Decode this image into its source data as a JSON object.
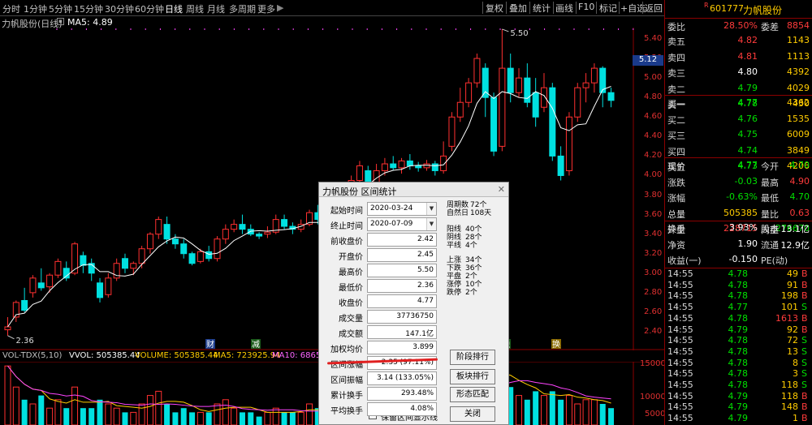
{
  "toolbar": {
    "periods": [
      "分时",
      "1分钟",
      "5分钟",
      "15分钟",
      "30分钟",
      "60分钟",
      "日线",
      "周线",
      "月线",
      "多周期",
      "更多"
    ],
    "active_period": "日线",
    "buttons": [
      "复权",
      "叠加",
      "统计",
      "画线",
      "F10",
      "标记",
      "+自选",
      "返回"
    ]
  },
  "chart": {
    "stock_label": "力帆股份(日线)",
    "ma_label": "MA5: 4.89",
    "high_mark": "5.50",
    "low_mark": "2.36",
    "price_axis": [
      "5.40",
      "5.20",
      "5.00",
      "4.80",
      "4.60",
      "4.40",
      "4.20",
      "4.00",
      "3.80",
      "3.60",
      "3.40",
      "3.20",
      "3.00",
      "2.80",
      "2.60",
      "2.40"
    ],
    "current_price_tag": "5.12",
    "event_markers": [
      "财",
      "减",
      "融",
      "换"
    ]
  },
  "volume": {
    "title": "VOL-TDX(5,10)",
    "vvol": "VVOL: 505385.44",
    "volume": "VOLUME: 505385.44",
    "ma5": "MA5: 723925.94",
    "ma10": "MA10: 686558",
    "axis": [
      "15000",
      "10000",
      "5000"
    ]
  },
  "panel": {
    "code": "601777",
    "name": "力帆股份",
    "weibi_label": "委比",
    "weibi": "28.50%",
    "weicha_label": "委差",
    "weicha": "8854",
    "sell": [
      {
        "label": "卖五",
        "price": "4.82",
        "vol": "1143"
      },
      {
        "label": "卖四",
        "price": "4.81",
        "vol": "1113"
      },
      {
        "label": "卖三",
        "price": "4.80",
        "vol": "4392"
      },
      {
        "label": "卖二",
        "price": "4.79",
        "vol": "4029"
      },
      {
        "label": "卖一",
        "price": "4.78",
        "vol": "430"
      }
    ],
    "buy": [
      {
        "label": "买一",
        "price": "4.77",
        "vol": "4362"
      },
      {
        "label": "买二",
        "price": "4.76",
        "vol": "1535"
      },
      {
        "label": "买三",
        "price": "4.75",
        "vol": "6009"
      },
      {
        "label": "买四",
        "price": "4.74",
        "vol": "3849"
      },
      {
        "label": "买五",
        "price": "4.73",
        "vol": "4206"
      }
    ],
    "quote": [
      {
        "l1": "现价",
        "v1": "4.77",
        "l2": "今开",
        "v2": "4.70"
      },
      {
        "l1": "涨跌",
        "v1": "-0.03",
        "l2": "最高",
        "v2": "4.90"
      },
      {
        "l1": "涨幅",
        "v1": "-0.63%",
        "l2": "最低",
        "v2": "4.70"
      },
      {
        "l1": "总量",
        "v1": "505385",
        "l2": "量比",
        "v2": "0.63"
      },
      {
        "l1": "外盘",
        "v1": "228715",
        "l2": "内盘",
        "v2": "276670"
      }
    ],
    "stats": [
      {
        "l1": "换手",
        "v1": "3.93%",
        "l2": "股本",
        "v2": "13.1亿"
      },
      {
        "l1": "净资",
        "v1": "1.90",
        "l2": "流通",
        "v2": "12.9亿"
      },
      {
        "l1": "收益(一)",
        "v1": "-0.150",
        "l2": "PE(动)",
        "v2": ""
      }
    ],
    "ticks": [
      {
        "time": "14:55",
        "price": "4.78",
        "vol": "49",
        "dir": "B"
      },
      {
        "time": "14:55",
        "price": "4.78",
        "vol": "91",
        "dir": "B"
      },
      {
        "time": "14:55",
        "price": "4.78",
        "vol": "198",
        "dir": "B"
      },
      {
        "time": "14:55",
        "price": "4.77",
        "vol": "101",
        "dir": "S"
      },
      {
        "time": "14:55",
        "price": "4.78",
        "vol": "1613",
        "dir": "B"
      },
      {
        "time": "14:55",
        "price": "4.79",
        "vol": "92",
        "dir": "B"
      },
      {
        "time": "14:55",
        "price": "4.78",
        "vol": "72",
        "dir": "S"
      },
      {
        "time": "14:55",
        "price": "4.78",
        "vol": "13",
        "dir": "S"
      },
      {
        "time": "14:55",
        "price": "4.78",
        "vol": "8",
        "dir": "S"
      },
      {
        "time": "14:55",
        "price": "4.78",
        "vol": "3",
        "dir": "S"
      },
      {
        "time": "14:55",
        "price": "4.78",
        "vol": "118",
        "dir": "S"
      },
      {
        "time": "14:55",
        "price": "4.79",
        "vol": "118",
        "dir": "B"
      },
      {
        "time": "14:55",
        "price": "4.79",
        "vol": "148",
        "dir": "B"
      },
      {
        "time": "14:55",
        "price": "4.79",
        "vol": "1",
        "dir": "B"
      }
    ]
  },
  "dialog": {
    "title": "力帆股份 区间统计",
    "fields": [
      {
        "label": "起始时间",
        "value": "2020-03-24",
        "type": "select"
      },
      {
        "label": "终止时间",
        "value": "2020-07-09",
        "type": "select"
      },
      {
        "label": "前收盘价",
        "value": "2.42"
      },
      {
        "label": "开盘价",
        "value": "2.45"
      },
      {
        "label": "最高价",
        "value": "5.50"
      },
      {
        "label": "最低价",
        "value": "2.36"
      },
      {
        "label": "收盘价",
        "value": "4.77"
      },
      {
        "label": "成交量",
        "value": "37736750"
      },
      {
        "label": "成交额",
        "value": "147.1亿"
      },
      {
        "label": "加权均价",
        "value": "3.899"
      },
      {
        "label": "区间涨幅",
        "value": "2.35 (97.11%)"
      },
      {
        "label": "区间振幅",
        "value": "3.14 (133.05%)"
      },
      {
        "label": "累计换手",
        "value": "293.48%"
      },
      {
        "label": "平均换手",
        "value": "4.08%"
      }
    ],
    "period_stats": [
      {
        "label": "周期数",
        "value": "72个"
      },
      {
        "label": "自然日",
        "value": "108天"
      }
    ],
    "candle_stats": [
      {
        "label": "阳线",
        "value": "40个"
      },
      {
        "label": "阴线",
        "value": "28个"
      },
      {
        "label": "平线",
        "value": "4个"
      }
    ],
    "move_stats": [
      {
        "label": "上涨",
        "value": "34个"
      },
      {
        "label": "下跌",
        "value": "36个"
      },
      {
        "label": "平盘",
        "value": "2个"
      },
      {
        "label": "涨停",
        "value": "10个"
      },
      {
        "label": "跌停",
        "value": "2个"
      }
    ],
    "buttons": [
      "阶段排行",
      "板块排行",
      "形态匹配",
      "关闭"
    ],
    "checkbox_label": "保留区间显示线"
  }
}
